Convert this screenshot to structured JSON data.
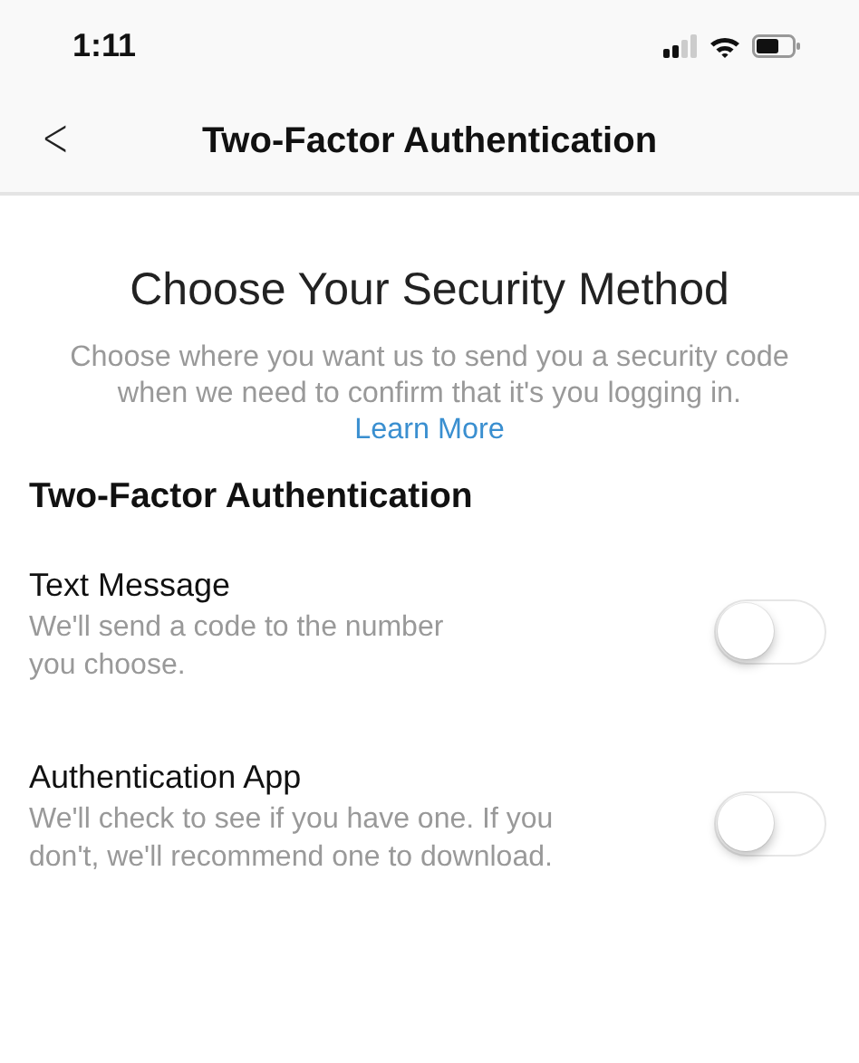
{
  "status_bar": {
    "time": "1:11"
  },
  "nav": {
    "back": "<",
    "title": "Two-Factor Authentication"
  },
  "intro": {
    "heading": "Choose Your Security Method",
    "text": "Choose where you want us to send you a security code when we need to confirm that it's you logging in.",
    "link": "Learn More"
  },
  "section": {
    "title": "Two-Factor Authentication"
  },
  "options": [
    {
      "title": "Text Message",
      "description_lines": [
        "We'll send a code to the number",
        "you choose."
      ],
      "on": false
    },
    {
      "title": "Authentication App",
      "description_lines": [
        "We'll check to see if you have one. If you",
        "don't, we'll recommend one to download."
      ],
      "on": false
    }
  ]
}
